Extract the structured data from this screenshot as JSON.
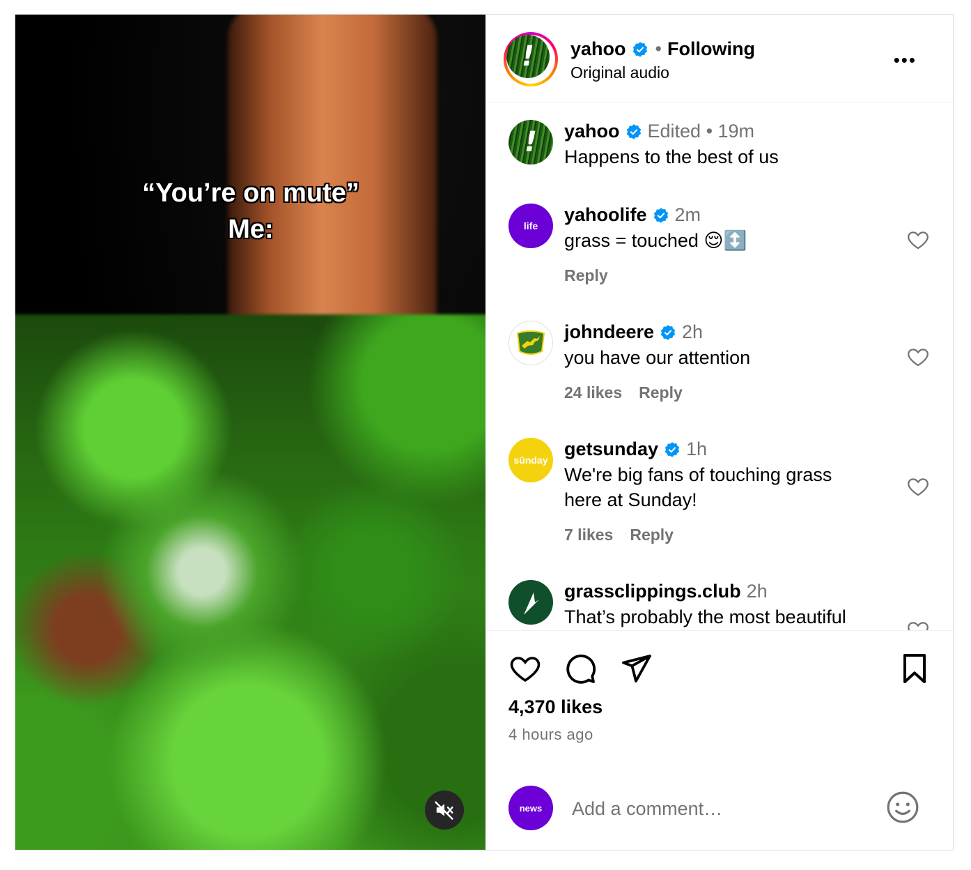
{
  "video": {
    "caption_line1": "“You’re on mute”",
    "caption_line2": "Me:",
    "mute_icon": "speaker-muted-icon"
  },
  "header": {
    "username": "yahoo",
    "separator": "•",
    "follow_status": "Following",
    "audio": "Original audio",
    "more_label": "•••"
  },
  "comments": [
    {
      "username": "yahoo",
      "meta": "Edited •  19m",
      "text": "Happens to the best of us"
    },
    {
      "username": "yahoolife",
      "avatar_text": "life",
      "meta": "2m",
      "text": "grass = touched 😌↕️",
      "reply": "Reply"
    },
    {
      "username": "johndeere",
      "meta": "2h",
      "text": "you have our attention",
      "likes": "24 likes",
      "reply": "Reply"
    },
    {
      "username": "getsunday",
      "avatar_text": "sūnday",
      "meta": "1h",
      "text": "We're big fans of touching grass here at Sunday!",
      "likes": "7 likes",
      "reply": "Reply"
    },
    {
      "username": "grassclippings.club",
      "meta": "2h",
      "text": "That’s probably the most beautiful"
    }
  ],
  "footer": {
    "likes": "4,370 likes",
    "time_ago": "4 hours ago",
    "add_comment_placeholder": "Add a comment…",
    "viewer_avatar_text": "news"
  },
  "colors": {
    "verified": "#0095f6",
    "muted_text": "#737373",
    "yahoo_purple": "#6b00d7",
    "sunday_yellow": "#f5d20e",
    "john_deere_green": "#367c2b"
  }
}
